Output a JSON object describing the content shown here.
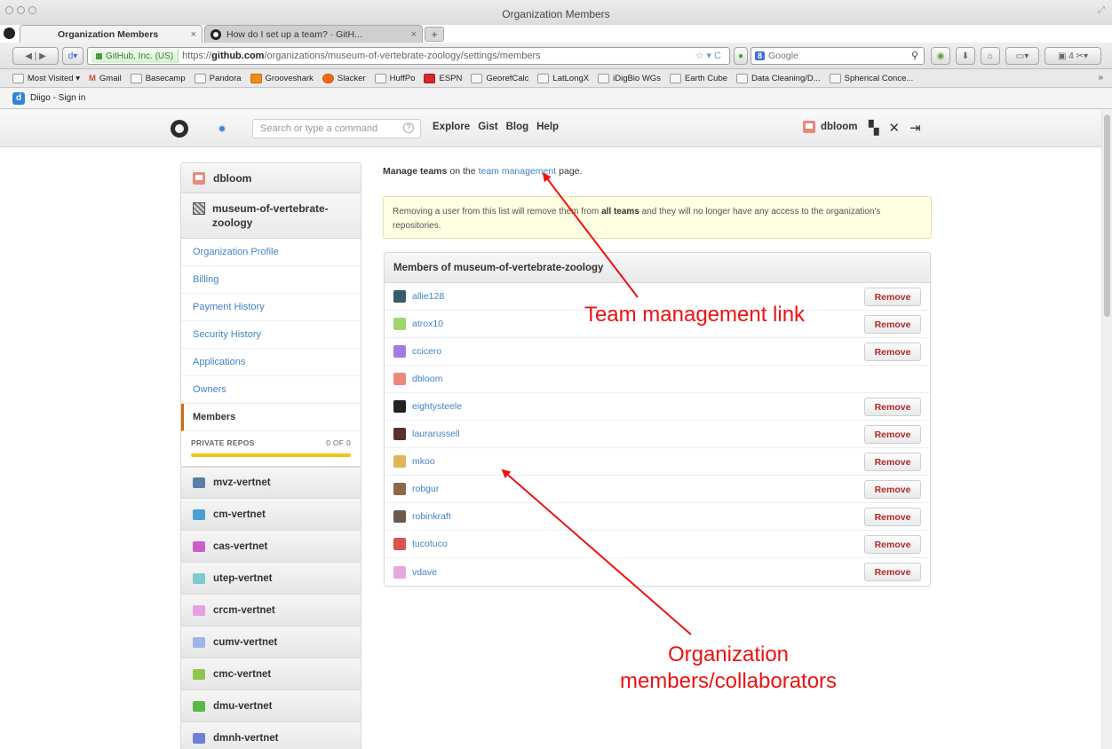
{
  "window": {
    "title": "Organization Members"
  },
  "tabs": [
    {
      "label": "Organization Members",
      "active": true
    },
    {
      "label": "How do I set up a team? · GitH...",
      "active": false
    }
  ],
  "address": {
    "site_identity": "GitHub, Inc. (US)",
    "url_prefix": "https://",
    "url_domain": "github.com",
    "url_path": "/organizations/museum-of-vertebrate-zoology/settings/members"
  },
  "browser_search": {
    "engine_icon": "8",
    "placeholder": "Google"
  },
  "bookmarks": [
    {
      "label": "Most Visited ▾",
      "icon": "folder-icon"
    },
    {
      "label": "Gmail",
      "icon": "gmail-icon"
    },
    {
      "label": "Basecamp",
      "icon": "page-icon"
    },
    {
      "label": "Pandora",
      "icon": "page-icon"
    },
    {
      "label": "Grooveshark",
      "icon": "grooveshark-icon"
    },
    {
      "label": "Slacker",
      "icon": "slacker-icon"
    },
    {
      "label": "HuffPo",
      "icon": "huffpo-icon"
    },
    {
      "label": "ESPN",
      "icon": "espn-icon"
    },
    {
      "label": "GeorefCalc",
      "icon": "page-icon"
    },
    {
      "label": "LatLongX",
      "icon": "page-icon"
    },
    {
      "label": "iDigBio WGs",
      "icon": "page-icon"
    },
    {
      "label": "Earth Cube",
      "icon": "page-icon"
    },
    {
      "label": "Data Cleaning/D...",
      "icon": "page-icon"
    },
    {
      "label": "Spherical Conce...",
      "icon": "page-icon"
    }
  ],
  "diigo": {
    "label": "Diigo - Sign in"
  },
  "github_header": {
    "search_placeholder": "Search or type a command",
    "nav": [
      "Explore",
      "Gist",
      "Blog",
      "Help"
    ],
    "username": "dbloom"
  },
  "sidebar": {
    "account": "dbloom",
    "organization": "museum-of-vertebrate-zoology",
    "links": [
      {
        "label": "Organization Profile",
        "selected": false
      },
      {
        "label": "Billing",
        "selected": false
      },
      {
        "label": "Payment History",
        "selected": false
      },
      {
        "label": "Security History",
        "selected": false
      },
      {
        "label": "Applications",
        "selected": false
      },
      {
        "label": "Owners",
        "selected": false
      },
      {
        "label": "Members",
        "selected": true
      }
    ],
    "private_repos": {
      "label": "PRIVATE REPOS",
      "count": "0 OF 0",
      "fill": 1.0
    },
    "teams": [
      {
        "name": "mvz-vertnet",
        "color": "#5a7fa6"
      },
      {
        "name": "cm-vertnet",
        "color": "#4a9fd4"
      },
      {
        "name": "cas-vertnet",
        "color": "#c960c9"
      },
      {
        "name": "utep-vertnet",
        "color": "#7fc9d0"
      },
      {
        "name": "crcm-vertnet",
        "color": "#e6a0e0"
      },
      {
        "name": "cumv-vertnet",
        "color": "#9fb4e8"
      },
      {
        "name": "cmc-vertnet",
        "color": "#8dc64a"
      },
      {
        "name": "dmu-vertnet",
        "color": "#5ab84a"
      },
      {
        "name": "dmnh-vertnet",
        "color": "#6f7fd9"
      }
    ]
  },
  "main": {
    "manage_bold": "Manage teams",
    "manage_pre": "on the",
    "manage_link": "team management",
    "manage_post": "page.",
    "flash": {
      "pre": "Removing a user from this list will remove them from",
      "bold": "all teams",
      "post": "and they will no longer have any access to the organization's repositories."
    },
    "members_title": "Members of museum-of-vertebrate-zoology",
    "remove_label": "Remove",
    "members": [
      {
        "name": "allie128",
        "removable": true,
        "color": "#3b5b6e"
      },
      {
        "name": "atrox10",
        "removable": true,
        "color": "#9fd66a"
      },
      {
        "name": "ccicero",
        "removable": true,
        "color": "#a27be0"
      },
      {
        "name": "dbloom",
        "removable": false,
        "color": "#e8897c"
      },
      {
        "name": "eightysteele",
        "removable": true,
        "color": "#222222"
      },
      {
        "name": "laurarussell",
        "removable": true,
        "color": "#5a2e2a"
      },
      {
        "name": "mkoo",
        "removable": true,
        "color": "#e2b45a"
      },
      {
        "name": "robgur",
        "removable": true,
        "color": "#8a6a4a"
      },
      {
        "name": "robinkraft",
        "removable": true,
        "color": "#6e5a4a"
      },
      {
        "name": "tucotuco",
        "removable": true,
        "color": "#d9534f"
      },
      {
        "name": "vdave",
        "removable": true,
        "color": "#e6a8e0"
      }
    ]
  },
  "annotations": {
    "team_link": "Team management link",
    "members_line1": "Organization",
    "members_line2": "members/collaborators",
    "color": "#ee1111"
  }
}
